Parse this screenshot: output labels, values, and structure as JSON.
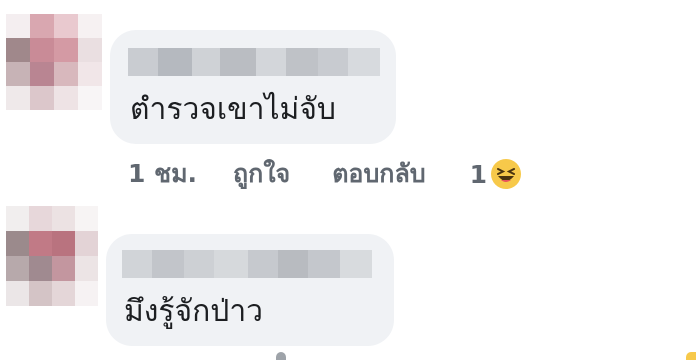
{
  "comments": [
    {
      "text": "ตำรวจเขาไม่จับ",
      "time": "1 ชม.",
      "like_label": "ถูกใจ",
      "reply_label": "ตอบกลับ",
      "reaction_count": "1",
      "reaction_icon": "laughing-emoji-icon"
    },
    {
      "text": "มึงรู้จักป่าว"
    }
  ],
  "colors": {
    "bubble": "#f0f2f5",
    "action_text": "#606770",
    "emoji": "#f7c94a"
  }
}
